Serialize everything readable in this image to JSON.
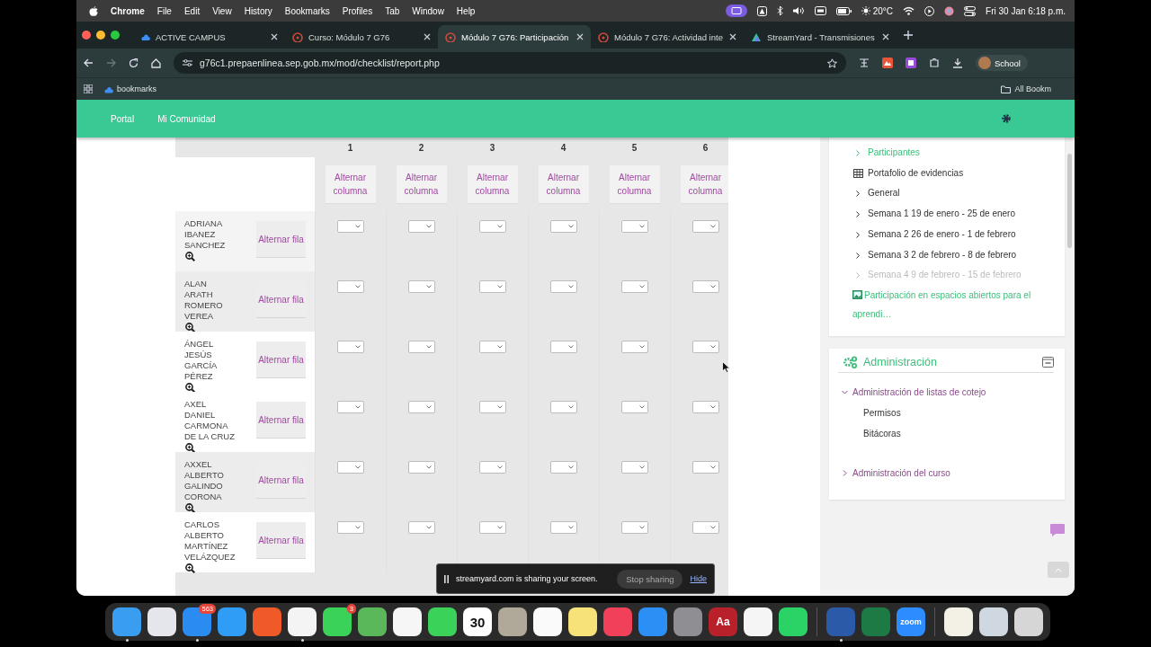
{
  "menu_bar": {
    "app": "Chrome",
    "menus": [
      "File",
      "Edit",
      "View",
      "History",
      "Bookmarks",
      "Profiles",
      "Tab",
      "Window",
      "Help"
    ],
    "temperature": "20°C",
    "clock": "Fri 30 Jan  6:18 p.m."
  },
  "tabs": [
    {
      "title": "ACTIVE CAMPUS",
      "kind": "cloud",
      "selected": false
    },
    {
      "title": "Curso: Módulo 7 G76",
      "kind": "moodle",
      "selected": false
    },
    {
      "title": "Módulo 7 G76: Participación",
      "kind": "moodle",
      "selected": true
    },
    {
      "title": "Módulo 7 G76: Actividad inte",
      "kind": "moodle",
      "selected": false
    },
    {
      "title": "StreamYard - Transmisiones",
      "kind": "streamyard",
      "selected": false
    }
  ],
  "address_bar": {
    "url": "g76c1.prepaenlinea.sep.gob.mx/mod/checklist/report.php",
    "profile": "School"
  },
  "bookmarks_bar": {
    "items": [
      "bookmarks"
    ],
    "all_bookmarks": "All Bookm"
  },
  "site_nav": {
    "links": [
      "Portal",
      "Mi Comunidad"
    ]
  },
  "checklist": {
    "columns": [
      {
        "number": "1",
        "toggle": "Alternar columna"
      },
      {
        "number": "2",
        "toggle": "Alternar columna"
      },
      {
        "number": "3",
        "toggle": "Alternar columna"
      },
      {
        "number": "4",
        "toggle": "Alternar columna"
      },
      {
        "number": "5",
        "toggle": "Alternar columna"
      },
      {
        "number": "6",
        "toggle": "Alternar columna"
      }
    ],
    "rows": [
      {
        "name": "ADRIANA IBANEZ SANCHEZ",
        "toggle": "Alternar fila"
      },
      {
        "name": "ALAN ARATH ROMERO VEREA",
        "toggle": "Alternar fila"
      },
      {
        "name": "ÁNGEL JESÚS GARCÍA PÉREZ",
        "toggle": "Alternar fila"
      },
      {
        "name": "AXEL DANIEL CARMONA DE LA CRUZ",
        "toggle": "Alternar fila"
      },
      {
        "name": "AXXEL ALBERTO GALINDO CORONA",
        "toggle": "Alternar fila"
      },
      {
        "name": "CARLOS ALBERTO MARTÍNEZ VELÁZQUEZ",
        "toggle": "Alternar fila"
      }
    ]
  },
  "navigation": {
    "items": [
      {
        "kind": "section",
        "label": "Participantes",
        "active": true,
        "dimmed": false
      },
      {
        "kind": "resource",
        "label": "Portafolio de evidencias",
        "active": false,
        "dimmed": false
      },
      {
        "kind": "section",
        "label": "General",
        "active": false,
        "dimmed": false
      },
      {
        "kind": "section",
        "label": "Semana 1 19 de enero - 25 de enero",
        "active": false,
        "dimmed": false
      },
      {
        "kind": "section",
        "label": "Semana 2 26 de enero - 1 de febrero",
        "active": false,
        "dimmed": false
      },
      {
        "kind": "section",
        "label": "Semana 3 2 de febrero - 8 de febrero",
        "active": false,
        "dimmed": false
      },
      {
        "kind": "section",
        "label": "Semana 4 9 de febrero - 15 de febrero",
        "active": false,
        "dimmed": true
      },
      {
        "kind": "activity",
        "label": "Participación en espacios abiertos para el aprendi…",
        "active": true,
        "dimmed": false
      }
    ]
  },
  "administration": {
    "title": "Administración",
    "items": [
      {
        "label": "Administración de listas de cotejo",
        "expanded": true,
        "children": [
          {
            "label": "Permisos"
          },
          {
            "label": "Bitácoras"
          }
        ]
      },
      {
        "label": "Administración del curso",
        "expanded": false
      }
    ]
  },
  "sharing_bar": {
    "message": "streamyard.com is sharing your screen.",
    "stop": "Stop sharing",
    "hide": "Hide"
  },
  "dock": {
    "groups": [
      [
        {
          "kind": "finder",
          "running": true
        },
        {
          "kind": "launchpad",
          "running": false
        },
        {
          "kind": "mail",
          "badge": "563",
          "running": true
        },
        {
          "kind": "safari",
          "running": false
        },
        {
          "kind": "brave",
          "running": false
        },
        {
          "kind": "chrome",
          "running": true
        },
        {
          "kind": "messages",
          "badge": "3",
          "running": false
        },
        {
          "kind": "maps",
          "running": false
        },
        {
          "kind": "photos",
          "running": false
        },
        {
          "kind": "facetime",
          "running": false
        },
        {
          "kind": "calendar",
          "label": "30",
          "running": false
        },
        {
          "kind": "contacts",
          "running": false
        },
        {
          "kind": "reminders",
          "running": false
        },
        {
          "kind": "notes",
          "running": false
        },
        {
          "kind": "music",
          "running": false
        },
        {
          "kind": "appstore",
          "running": false
        },
        {
          "kind": "settings",
          "running": false
        },
        {
          "kind": "dictionary",
          "label": "Aa",
          "running": false
        },
        {
          "kind": "stripes",
          "running": false
        },
        {
          "kind": "whatsapp",
          "running": false
        }
      ],
      [
        {
          "kind": "word",
          "running": true
        },
        {
          "kind": "excel",
          "running": false
        },
        {
          "kind": "zoom",
          "label": "zoom",
          "running": false
        }
      ],
      [
        {
          "kind": "preview",
          "running": false
        },
        {
          "kind": "downloads",
          "running": false
        },
        {
          "kind": "trash",
          "running": false
        }
      ]
    ]
  }
}
